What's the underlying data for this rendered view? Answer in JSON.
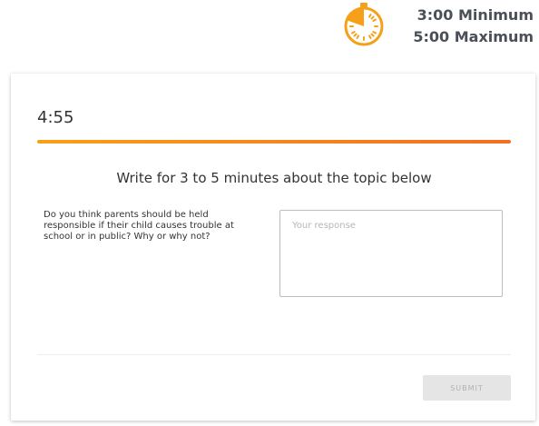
{
  "header": {
    "timer_icon": "stopwatch-icon",
    "minimum_label": "3:00 Minimum",
    "maximum_label": "5:00 Maximum"
  },
  "main": {
    "time_remaining": "4:55",
    "progress": 1.0,
    "instruction": "Write for 3 to 5 minutes about the topic below",
    "prompt": "Do you think parents should be held responsible if their child causes trouble at school or in public? Why or why not?",
    "response": {
      "value": "",
      "placeholder": "Your response"
    },
    "submit_label": "SUBMIT"
  },
  "colors": {
    "accent": "#f6a01a",
    "accent_end": "#f36f21",
    "text": "#333333",
    "submit_bg": "#e5e5e5"
  }
}
